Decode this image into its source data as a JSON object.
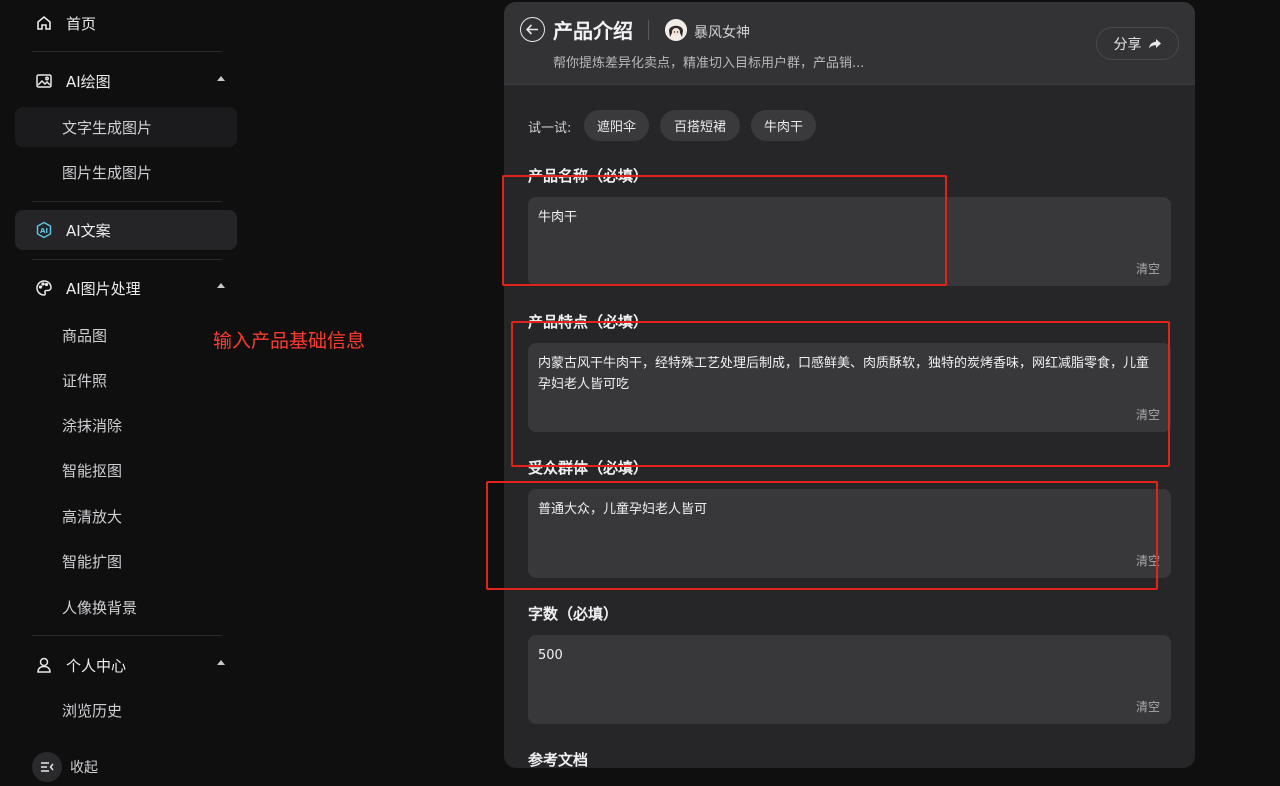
{
  "sidebar": {
    "home": "首页",
    "ai_drawing": "AI绘图",
    "text_to_image": "文字生成图片",
    "image_to_image": "图片生成图片",
    "ai_copy": "AI文案",
    "ai_image_processing": "AI图片处理",
    "sub_items": [
      "商品图",
      "证件照",
      "涂抹消除",
      "智能抠图",
      "高清放大",
      "智能扩图",
      "人像换背景"
    ],
    "personal_center": "个人中心",
    "history": "浏览历史",
    "collapse": "收起"
  },
  "annotation": "输入产品基础信息",
  "panel": {
    "title": "产品介绍",
    "author": "暴风女神",
    "description": "帮你提炼差异化卖点，精准切入目标用户群，产品销...",
    "share": "分享",
    "try_label": "试一试:",
    "chips": [
      "遮阳伞",
      "百搭短裙",
      "牛肉干"
    ],
    "fields": [
      {
        "label": "产品名称（必填）",
        "value": "牛肉干",
        "clear": "清空"
      },
      {
        "label": "产品特点（必填）",
        "value": "内蒙古风干牛肉干，经特殊工艺处理后制成，口感鲜美、肉质酥软，独特的炭烤香味，网红减脂零食，儿童孕妇老人皆可吃",
        "clear": "清空"
      },
      {
        "label": "受众群体（必填）",
        "value": "普通大众，儿童孕妇老人皆可",
        "clear": "清空"
      },
      {
        "label": "字数（必填）",
        "value": "500",
        "clear": "清空"
      }
    ],
    "reference_label": "参考文档"
  },
  "colors": {
    "background": "#0f0f10",
    "panel": "#262629",
    "annotation_red": "#e2231a"
  }
}
